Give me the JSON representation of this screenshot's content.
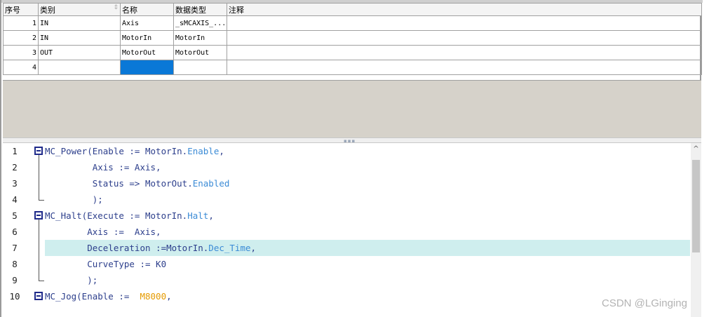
{
  "table": {
    "headers": [
      "序号",
      "类别",
      "名称",
      "数据类型",
      "注释"
    ],
    "rows": [
      {
        "num": "1",
        "category": "IN",
        "name": "Axis",
        "type": "_sMCAXIS_...",
        "comment": ""
      },
      {
        "num": "2",
        "category": "IN",
        "name": "MotorIn",
        "type": "MotorIn",
        "comment": ""
      },
      {
        "num": "3",
        "category": "OUT",
        "name": "MotorOut",
        "type": "MotorOut",
        "comment": ""
      },
      {
        "num": "4",
        "category": "",
        "name": "",
        "type": "",
        "comment": ""
      }
    ],
    "selected_cell": {
      "row": 4,
      "column": "名称"
    }
  },
  "editor": {
    "lines": [
      {
        "n": "1",
        "code": [
          {
            "t": "MC_Power(Enable := MotorIn."
          },
          {
            "t": "Enable",
            "c": "mem"
          },
          {
            "t": ","
          }
        ]
      },
      {
        "n": "2",
        "code": [
          {
            "t": "         Axis := Axis,"
          }
        ]
      },
      {
        "n": "3",
        "code": [
          {
            "t": "         Status => MotorOut."
          },
          {
            "t": "Enabled",
            "c": "mem"
          }
        ]
      },
      {
        "n": "4",
        "code": [
          {
            "t": "         );"
          }
        ]
      },
      {
        "n": "5",
        "code": [
          {
            "t": "MC_Halt(Execute := MotorIn."
          },
          {
            "t": "Halt",
            "c": "mem"
          },
          {
            "t": ","
          }
        ]
      },
      {
        "n": "6",
        "code": [
          {
            "t": "        Axis :=  Axis,"
          }
        ]
      },
      {
        "n": "7",
        "code": [
          {
            "t": "        Deceleration :=MotorIn."
          },
          {
            "t": "Dec_Time",
            "c": "mem"
          },
          {
            "t": ","
          }
        ],
        "highlight": true
      },
      {
        "n": "8",
        "code": [
          {
            "t": "        CurveType := K0"
          }
        ]
      },
      {
        "n": "9",
        "code": [
          {
            "t": "        );"
          }
        ]
      },
      {
        "n": "10",
        "code": [
          {
            "t": "MC_Jog(Enable :=  "
          },
          {
            "t": "M8000",
            "c": "lit"
          },
          {
            "t": ","
          }
        ]
      }
    ]
  },
  "watermark": "CSDN @LGinging",
  "colors": {
    "selection": "#0a78d7",
    "line_highlight": "#cfeeee",
    "keyword": "#2d3f8c",
    "member": "#3b8bd6",
    "literal": "#e59a00"
  }
}
